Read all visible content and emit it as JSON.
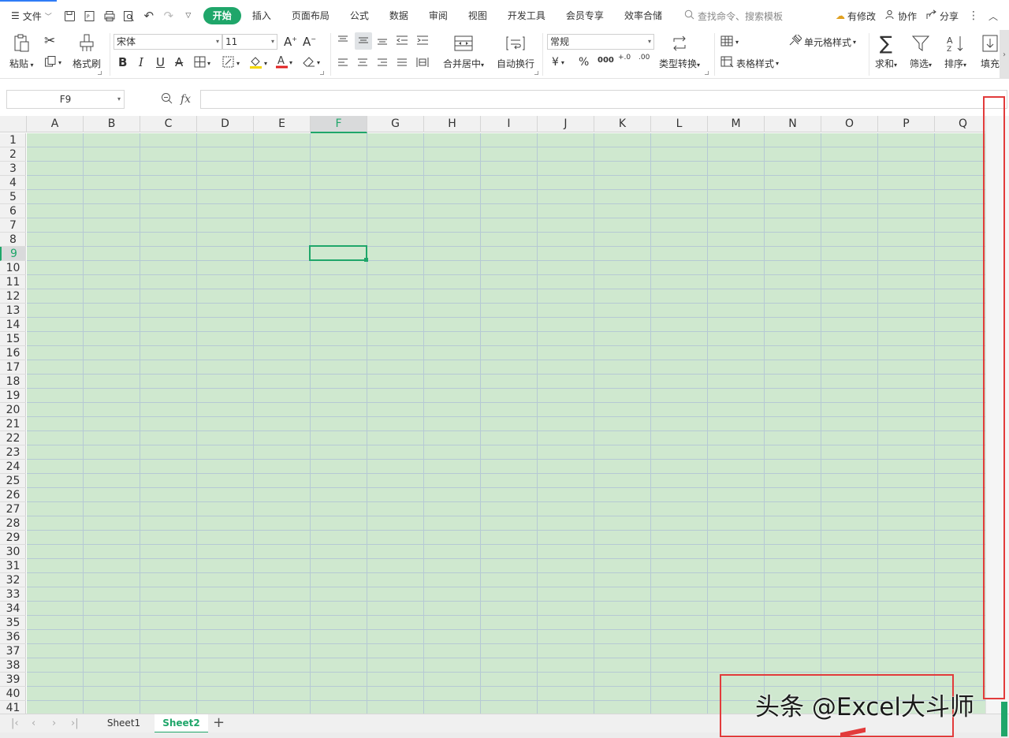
{
  "tabbar": {
    "menu_label": "文件",
    "tabs": [
      "开始",
      "插入",
      "页面布局",
      "公式",
      "数据",
      "审阅",
      "视图",
      "开发工具",
      "会员专享",
      "效率合储"
    ],
    "active_tab": "开始",
    "search_placeholder": "查找命令、搜索模板",
    "has_changes": "有修改",
    "collaborate": "协作",
    "share": "分享"
  },
  "ribbon": {
    "paste": "粘贴",
    "format_painter": "格式刷",
    "font_name": "宋体",
    "font_size": "11",
    "merge_center": "合并居中",
    "wrap_text": "自动换行",
    "number_format": "常规",
    "type_convert": "类型转换",
    "cell_style": "单元格样式",
    "table_style": "表格样式",
    "sum": "求和",
    "filter": "筛选",
    "sort": "排序",
    "fill": "填充",
    "currency_symbol": "¥",
    "percent_symbol": "%",
    "thousands_symbol": "000",
    "inc_decimal": "+.0",
    "dec_decimal": ".00"
  },
  "formula_bar": {
    "name_box": "F9",
    "fx_label": "fx",
    "formula": ""
  },
  "grid": {
    "columns": [
      "A",
      "B",
      "C",
      "D",
      "E",
      "F",
      "G",
      "H",
      "I",
      "J",
      "K",
      "L",
      "M",
      "N",
      "O",
      "P",
      "Q"
    ],
    "rows": [
      "1",
      "2",
      "3",
      "4",
      "5",
      "6",
      "7",
      "8",
      "9",
      "10",
      "11",
      "12",
      "13",
      "14",
      "15",
      "16",
      "17",
      "18",
      "19",
      "20",
      "21",
      "22",
      "23",
      "24",
      "25",
      "26",
      "27",
      "28",
      "29",
      "30",
      "31",
      "32",
      "33",
      "34",
      "35",
      "36",
      "37",
      "38",
      "39",
      "40",
      "41"
    ],
    "selected_column": "F",
    "selected_row": "9",
    "cell_fill_color": "#cfe8cf",
    "accent_color": "#1fa66a"
  },
  "sheets": {
    "tabs": [
      "Sheet1",
      "Sheet2"
    ],
    "active": "Sheet2",
    "add_label": "+"
  },
  "watermark": "头条 @Excel大斗师"
}
